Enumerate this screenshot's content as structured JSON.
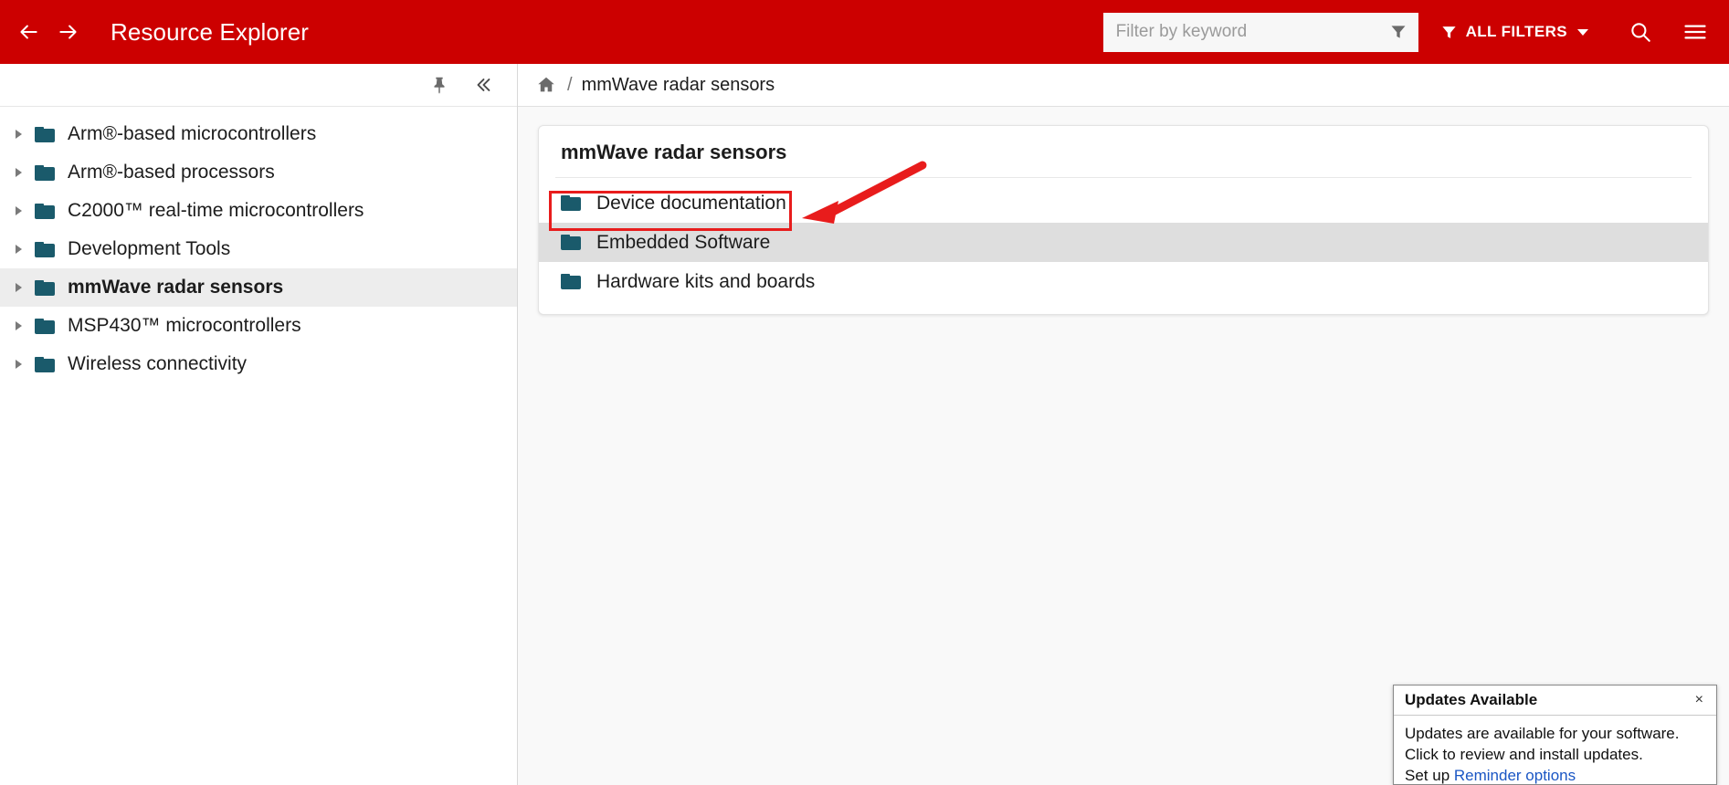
{
  "header": {
    "app_title": "Resource Explorer",
    "back_icon": "arrow-left-icon",
    "forward_icon": "arrow-right-icon",
    "filter": {
      "placeholder": "Filter by keyword",
      "value": "",
      "funnel_icon": "funnel-icon"
    },
    "all_filters_label": "ALL FILTERS",
    "all_filters_icon": "funnel-icon",
    "search_icon": "search-icon",
    "menu_icon": "hamburger-menu-icon",
    "background_color": "#cc0000"
  },
  "sidebar": {
    "pin_icon": "pin-icon",
    "collapse_icon": "double-chevron-left-icon",
    "items": [
      {
        "label": "Arm®-based microcontrollers",
        "selected": false
      },
      {
        "label": "Arm®-based processors",
        "selected": false
      },
      {
        "label": "C2000™ real-time microcontrollers",
        "selected": false
      },
      {
        "label": "Development Tools",
        "selected": false
      },
      {
        "label": "mmWave radar sensors",
        "selected": true
      },
      {
        "label": "MSP430™ microcontrollers",
        "selected": false
      },
      {
        "label": "Wireless connectivity",
        "selected": false
      }
    ],
    "folder_color": "#1a5a6b"
  },
  "breadcrumb": {
    "home_icon": "home-icon",
    "separator": "/",
    "current": "mmWave radar sensors"
  },
  "content": {
    "card_title": "mmWave radar sensors",
    "rows": [
      {
        "label": "Device documentation",
        "highlighted": false
      },
      {
        "label": "Embedded Software",
        "highlighted": true
      },
      {
        "label": "Hardware kits and boards",
        "highlighted": false
      }
    ],
    "annotation_color": "#e81c1c"
  },
  "notification": {
    "title": "Updates Available",
    "close_label": "×",
    "line1": "Updates are available for your software.",
    "line2": "Click to review and install updates.",
    "line3_prefix": "Set up ",
    "line3_link": "Reminder options",
    "link_color": "#1a56c4"
  }
}
